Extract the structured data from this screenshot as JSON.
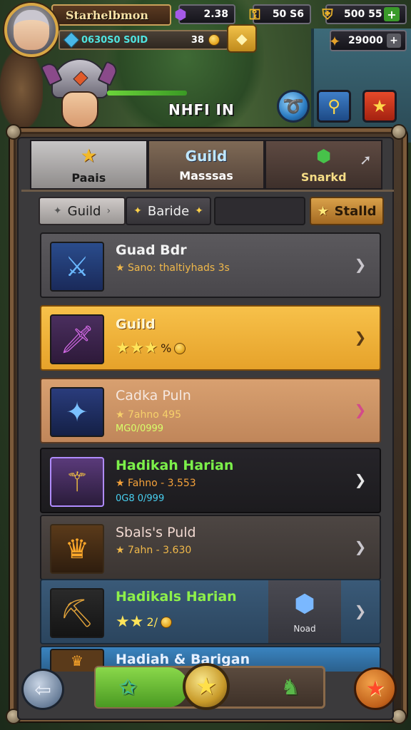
{
  "player": {
    "name": "Starhelbmon",
    "xp_text": "0630S0 S0ID",
    "level_value": "38"
  },
  "resources": [
    {
      "icon": "potion-icon",
      "value": "2.38"
    },
    {
      "icon": "key-icon",
      "value": "50 S6"
    },
    {
      "icon": "shield-gem-icon",
      "value": "500 55"
    },
    {
      "icon": "gold-bars-icon",
      "value": "29000"
    }
  ],
  "hero": {
    "name": "NHFI IN"
  },
  "tabs": [
    {
      "top": "",
      "label": "Paais"
    },
    {
      "top": "Guild",
      "label": "Masssas"
    },
    {
      "top": "",
      "label": "Snarkd"
    }
  ],
  "filters": {
    "guild": "Guild",
    "baride": "Baride",
    "stalld": "Stalld"
  },
  "items": [
    {
      "title": "Guad Bdr",
      "sub": "★ Sano: thaltiyhads 3s"
    },
    {
      "title": "Guild",
      "suffix": "%"
    },
    {
      "title": "Cadka Puln",
      "sub": "★ 7ahno 495",
      "sub2": "MG0/0999"
    },
    {
      "title": "Hadikah Harian",
      "sub": "★ Fahno - 3.553",
      "sub2": "0G8 0/999"
    },
    {
      "title": "Sbals's Puld",
      "sub": "★ 7ahn - 3.630"
    },
    {
      "title": "Hadikals Harian",
      "suffix": "2/",
      "badge": "Noad"
    },
    {
      "title": "Hadiah & Barigan"
    }
  ],
  "colors": {
    "accent_gold": "#f7c14a",
    "accent_green": "#7cf04a",
    "panel_frame": "#7b5a3a"
  }
}
